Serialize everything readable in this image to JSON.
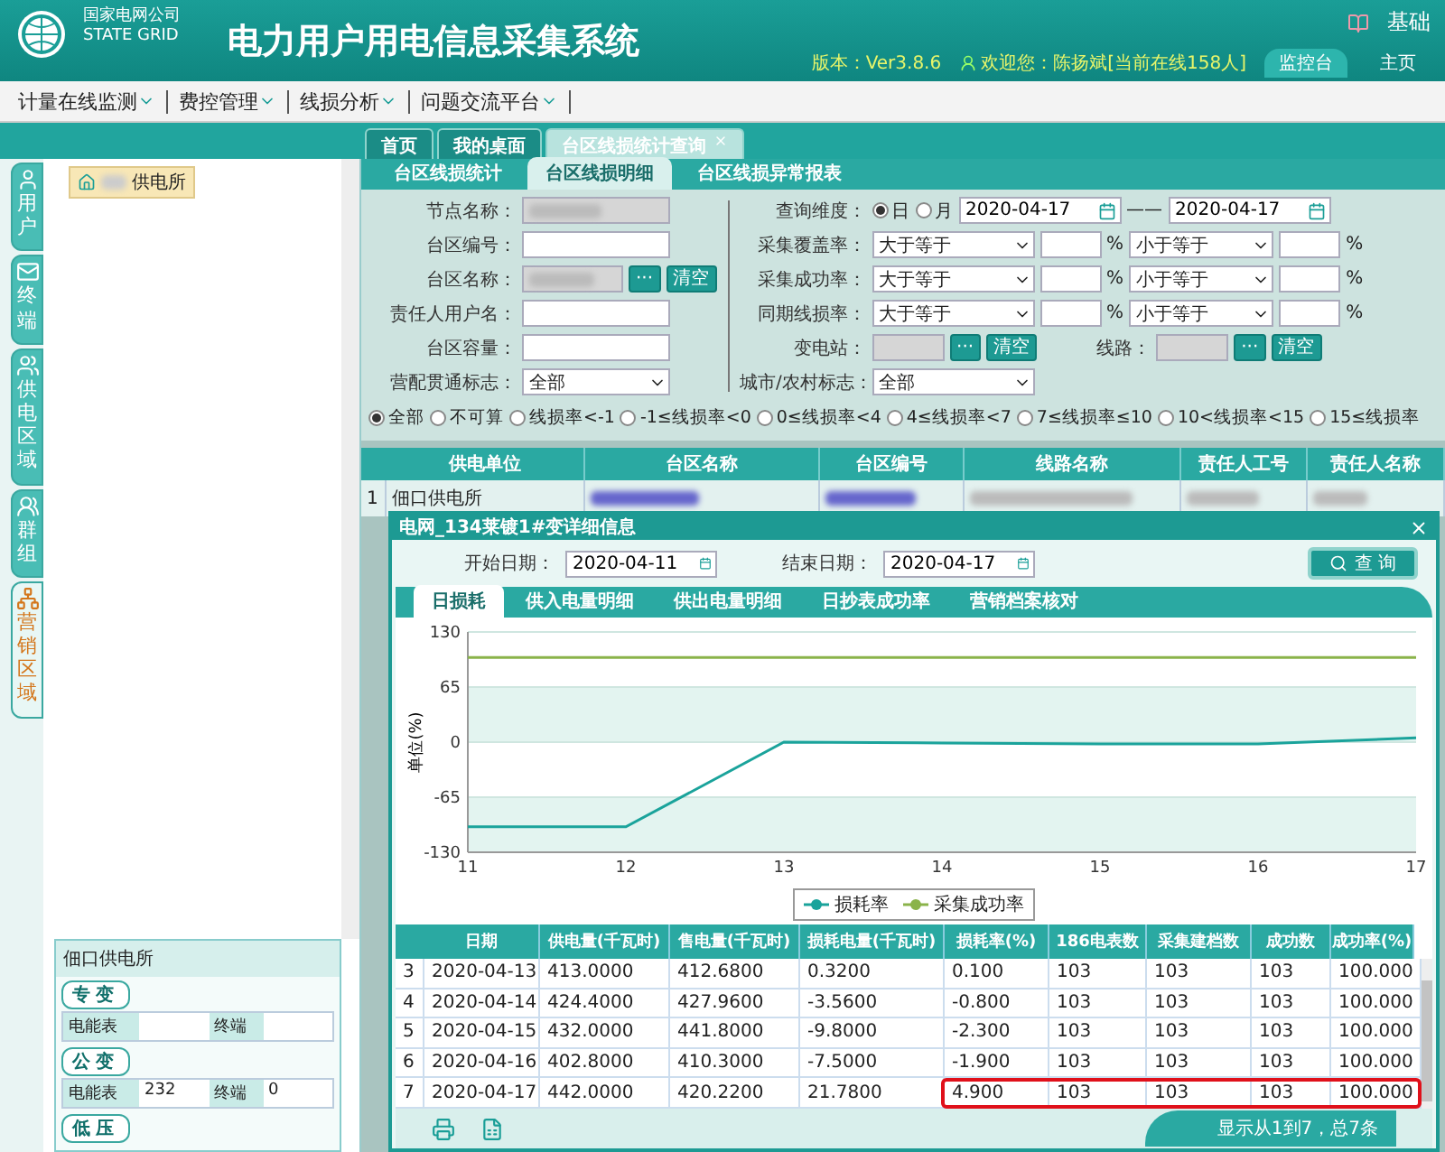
{
  "header": {
    "org_name": "国家电网公司",
    "org_name_en": "STATE GRID",
    "title": "电力用户用电信息采集系统",
    "corner_label": "基础",
    "version": "版本：Ver3.8.6",
    "welcome": "欢迎您：陈扬斌[当前在线158人]",
    "links": [
      {
        "label": "监控台",
        "selected": true
      },
      {
        "label": "主页",
        "selected": false
      }
    ]
  },
  "menu": [
    {
      "label": "计量在线监测"
    },
    {
      "label": "费控管理"
    },
    {
      "label": "线损分析"
    },
    {
      "label": "问题交流平台"
    }
  ],
  "page_tabs": [
    {
      "label": "首页",
      "selected": false,
      "closable": false
    },
    {
      "label": "我的桌面",
      "selected": false,
      "closable": false
    },
    {
      "label": "台区线损统计查询",
      "selected": true,
      "closable": true
    }
  ],
  "side_tabs": [
    {
      "label": "用户",
      "selected": false
    },
    {
      "label": "终端",
      "selected": false
    },
    {
      "label": "供电区域",
      "selected": false
    },
    {
      "label": "群组",
      "selected": false
    },
    {
      "label": "营销区域",
      "selected": true
    }
  ],
  "tree": {
    "node": "供电所"
  },
  "info_panel": {
    "title": "佃口供电所",
    "sections": [
      {
        "label": "专变",
        "fields": [
          {
            "label": "电能表"
          },
          {
            "label": "终端"
          }
        ]
      },
      {
        "label": "公变",
        "fields": [
          {
            "label": "电能表",
            "value": "232"
          },
          {
            "label": "终端",
            "value": "0"
          }
        ]
      },
      {
        "label": "低压"
      }
    ]
  },
  "sub_tabs": [
    {
      "label": "台区线损统计",
      "selected": false
    },
    {
      "label": "台区线损明细",
      "selected": true
    },
    {
      "label": "台区线损异常报表",
      "selected": false
    }
  ],
  "form": {
    "left": [
      {
        "label": "节点名称：",
        "kind": "text",
        "disabled": true,
        "redacted": true
      },
      {
        "label": "台区编号：",
        "kind": "text",
        "disabled": false,
        "redacted": false
      },
      {
        "label": "台区名称：",
        "kind": "picker",
        "disabled": true,
        "redacted": true,
        "buttons": [
          "···",
          "清空"
        ]
      },
      {
        "label": "责任人用户名：",
        "kind": "text",
        "disabled": false,
        "redacted": false
      },
      {
        "label": "台区容量：",
        "kind": "text",
        "disabled": false,
        "redacted": false
      },
      {
        "label": "营配贯通标志：",
        "kind": "select",
        "value": "全部"
      }
    ],
    "period": {
      "label": "查询维度：",
      "options": [
        {
          "label": "日",
          "selected": true
        },
        {
          "label": "月",
          "selected": false
        }
      ],
      "from": "2020-04-17",
      "separator": "——",
      "to": "2020-04-17"
    },
    "ranges": [
      {
        "label": "采集覆盖率：",
        "op1": "大于等于",
        "unit1": "%",
        "op2": "小于等于",
        "unit2": "%"
      },
      {
        "label": "采集成功率：",
        "op1": "大于等于",
        "unit1": "%",
        "op2": "小于等于",
        "unit2": "%"
      },
      {
        "label": "同期线损率：",
        "op1": "大于等于",
        "unit1": "%",
        "op2": "小于等于",
        "unit2": "%"
      }
    ],
    "substation": {
      "label": "变电站：",
      "buttons": [
        "···",
        "清空"
      ]
    },
    "line": {
      "label": "线路：",
      "buttons": [
        "···",
        "清空"
      ]
    },
    "area_flag": {
      "label": "城市/农村标志：",
      "value": "全部"
    }
  },
  "filters": [
    {
      "label": "全部",
      "selected": true
    },
    {
      "label": "不可算",
      "selected": false
    },
    {
      "label": "线损率<-1",
      "selected": false
    },
    {
      "label": "-1≤线损率<0",
      "selected": false
    },
    {
      "label": "0≤线损率<4",
      "selected": false
    },
    {
      "label": "4≤线损率<7",
      "selected": false
    },
    {
      "label": "7≤线损率≤10",
      "selected": false
    },
    {
      "label": "10<线损率<15",
      "selected": false
    },
    {
      "label": "15≤线损率",
      "selected": false
    }
  ],
  "result_table": {
    "columns": [
      "供电单位",
      "台区名称",
      "台区编号",
      "线路名称",
      "责任人工号",
      "责任人名称"
    ],
    "rows": [
      {
        "index": "1",
        "unit": "佃口供电所"
      }
    ]
  },
  "dialog": {
    "title": "电网_134莱镀1#变详细信息",
    "start_label": "开始日期：",
    "start": "2020-04-11",
    "end_label": "结束日期：",
    "end": "2020-04-17",
    "query_button": "查 询",
    "tabs": [
      {
        "label": "日损耗",
        "selected": true
      },
      {
        "label": "供入电量明细",
        "selected": false
      },
      {
        "label": "供出电量明细",
        "selected": false
      },
      {
        "label": "日抄表成功率",
        "selected": false
      },
      {
        "label": "营销档案核对",
        "selected": false
      }
    ],
    "chart_data": {
      "type": "line",
      "grid": true,
      "ylabel": "单位(%)",
      "x": [
        "11",
        "12",
        "13",
        "14",
        "15",
        "16",
        "17"
      ],
      "ylim": [
        -130,
        130
      ],
      "yticks": [
        -130,
        -65,
        0,
        65,
        130
      ],
      "series": [
        {
          "name": "损耗率",
          "color": "#1aa39b",
          "values": [
            -100,
            -100,
            0,
            -1,
            -2,
            -2,
            5
          ]
        },
        {
          "name": "采集成功率",
          "color": "#8ab34a",
          "values": [
            100,
            100,
            100,
            100,
            100,
            100,
            100
          ]
        }
      ]
    },
    "table": {
      "columns": [
        "日期",
        "供电量(千瓦时)",
        "售电量(千瓦时)",
        "损耗电量(千瓦时)",
        "损耗率(%)",
        "186电表数",
        "采集建档数",
        "成功数",
        "成功率(%)"
      ],
      "rows": [
        {
          "index": "3",
          "cells": [
            "2020-04-13",
            "413.0000",
            "412.6800",
            "0.3200",
            "0.100",
            "103",
            "103",
            "103",
            "100.000"
          ],
          "highlighted": false
        },
        {
          "index": "4",
          "cells": [
            "2020-04-14",
            "424.4000",
            "427.9600",
            "-3.5600",
            "-0.800",
            "103",
            "103",
            "103",
            "100.000"
          ],
          "highlighted": false
        },
        {
          "index": "5",
          "cells": [
            "2020-04-15",
            "432.0000",
            "441.8000",
            "-9.8000",
            "-2.300",
            "103",
            "103",
            "103",
            "100.000"
          ],
          "highlighted": false
        },
        {
          "index": "6",
          "cells": [
            "2020-04-16",
            "402.8000",
            "410.3000",
            "-7.5000",
            "-1.900",
            "103",
            "103",
            "103",
            "100.000"
          ],
          "highlighted": false
        },
        {
          "index": "7",
          "cells": [
            "2020-04-17",
            "442.0000",
            "420.2200",
            "21.7800",
            "4.900",
            "103",
            "103",
            "103",
            "100.000"
          ],
          "highlighted": true
        }
      ]
    },
    "footer": "显示从1到7，总7条"
  }
}
